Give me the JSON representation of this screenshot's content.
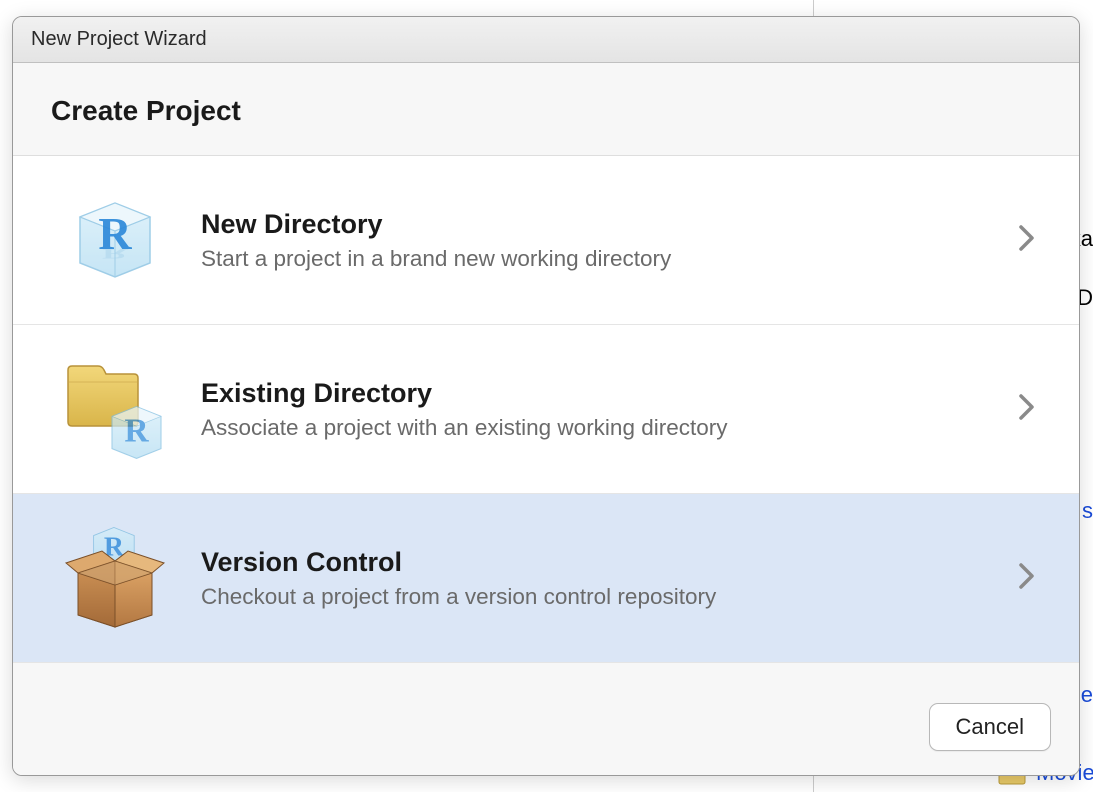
{
  "dialog": {
    "title": "New Project Wizard",
    "heading": "Create Project",
    "options": [
      {
        "title": "New Directory",
        "description": "Start a project in a brand new working directory",
        "icon": "new-directory-icon"
      },
      {
        "title": "Existing Directory",
        "description": "Associate a project with an existing working directory",
        "icon": "existing-directory-icon"
      },
      {
        "title": "Version Control",
        "description": "Checkout a project from a version control repository",
        "icon": "version-control-icon"
      }
    ],
    "selected_index": 2,
    "cancel_label": "Cancel"
  },
  "background": {
    "partial_text_1": "ka",
    "partial_text_2": "D",
    "partial_link_1": "s",
    "partial_link_2": "e",
    "partial_link_3": "Movies"
  }
}
